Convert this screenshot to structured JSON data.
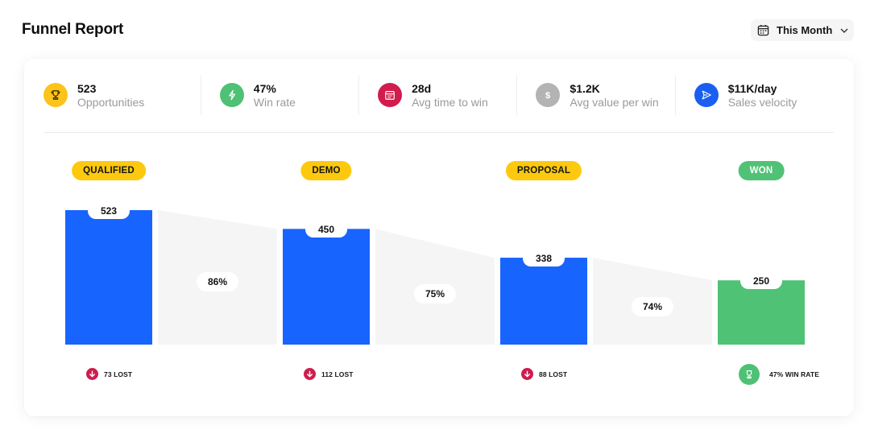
{
  "header": {
    "title": "Funnel Report",
    "period": {
      "selected": "This Month",
      "icon": "calendar-icon",
      "chevron": "chevron-down-icon"
    }
  },
  "kpis": [
    {
      "value": "523",
      "label": "Opportunities",
      "icon": "trophy-icon",
      "color": "#fcc419"
    },
    {
      "value": "47%",
      "label": "Win rate",
      "icon": "bolt-icon",
      "color": "#4fc174"
    },
    {
      "value": "28d",
      "label": "Avg time to win",
      "icon": "calendar-icon",
      "color": "#d21c4c"
    },
    {
      "value": "$1.2K",
      "label": "Avg value per win",
      "icon": "dollar-icon",
      "color": "#b3b3b3"
    },
    {
      "value": "$11K/day",
      "label": "Sales velocity",
      "icon": "send-icon",
      "color": "#1a5ff0"
    }
  ],
  "colors": {
    "bar_primary": "#1864ff",
    "bar_won": "#50c275",
    "connector": "#f5f5f6",
    "pill_yellow": "#fdc90f",
    "pill_green": "#50c275",
    "lost": "#cc1e4d"
  },
  "chart_data": {
    "type": "bar",
    "title": "Funnel Report",
    "categories": [
      "QUALIFIED",
      "DEMO",
      "PROPOSAL",
      "WON"
    ],
    "values": [
      523,
      450,
      338,
      250
    ],
    "value_labels": [
      "523",
      "450",
      "338",
      "250"
    ],
    "conversion_rates": [
      "86%",
      "75%",
      "74%"
    ],
    "footers": [
      "73 LOST",
      "112 LOST",
      "88 LOST",
      "47% WIN RATE"
    ],
    "footer_icons": [
      "arrow-down-icon",
      "arrow-down-icon",
      "arrow-down-icon",
      "trophy-icon"
    ],
    "ylim": [
      0,
      523
    ],
    "grid": false,
    "xlabel": "",
    "ylabel": ""
  }
}
